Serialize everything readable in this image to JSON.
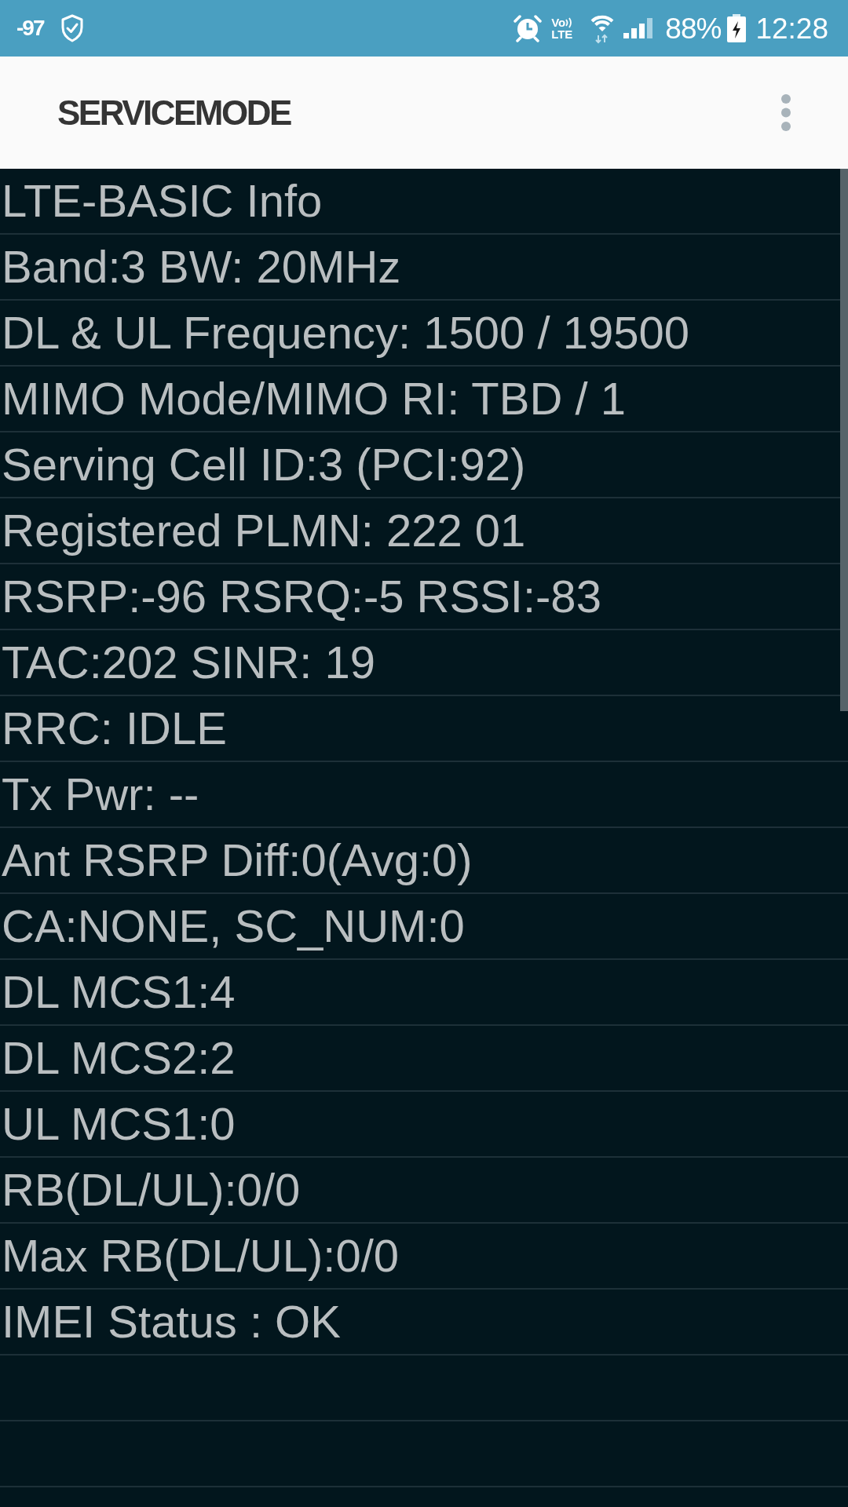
{
  "status_bar": {
    "signal_reading": "-97",
    "volte": {
      "top": "Vo",
      "bottom": "LTE"
    },
    "battery_percent": "88%",
    "charging": true,
    "time": "12:28"
  },
  "app_bar": {
    "title": "SERVICEMODE"
  },
  "lines": [
    "LTE-BASIC Info",
    "Band:3 BW: 20MHz",
    "DL & UL Frequency: 1500 / 19500",
    "MIMO Mode/MIMO RI: TBD / 1",
    "Serving Cell ID:3 (PCI:92)",
    "Registered PLMN: 222 01",
    "RSRP:-96 RSRQ:-5 RSSI:-83",
    "TAC:202 SINR: 19",
    "RRC: IDLE",
    "Tx Pwr: --",
    "Ant RSRP Diff:0(Avg:0)",
    "CA:NONE, SC_NUM:0",
    "DL MCS1:4",
    "DL MCS2:2",
    "UL MCS1:0",
    "RB(DL/UL):0/0",
    "Max RB(DL/UL):0/0",
    "IMEI Status : OK"
  ]
}
